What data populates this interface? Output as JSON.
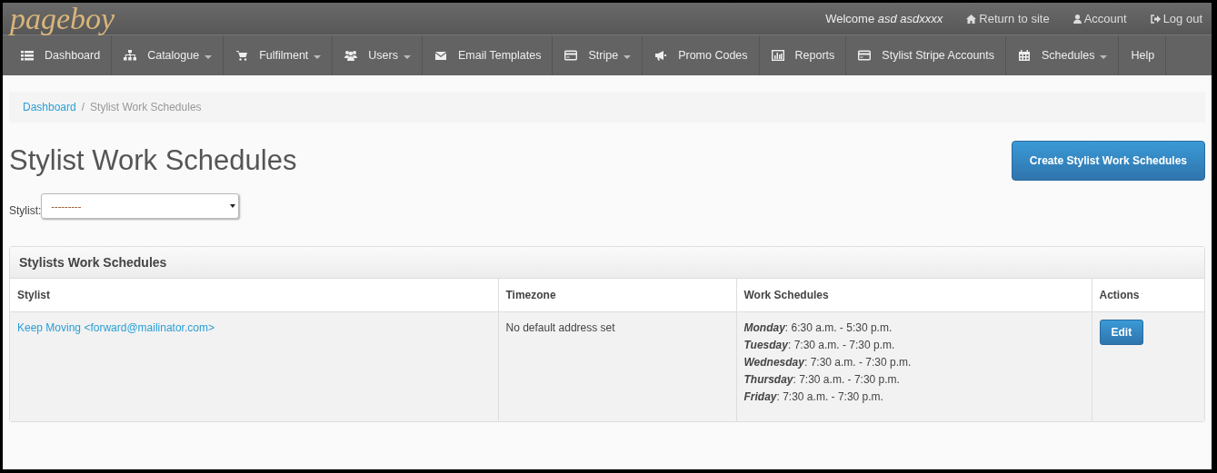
{
  "brand": {
    "logo": "pageboy"
  },
  "topbar": {
    "welcome": "Welcome *asd asdxxxx*",
    "links": [
      "Return to site",
      "Account",
      "Log out"
    ]
  },
  "nav": [
    {
      "label": "Dashboard",
      "dropdown": false
    },
    {
      "label": "Catalogue",
      "dropdown": true
    },
    {
      "label": "Fulfilment",
      "dropdown": true
    },
    {
      "label": "Users",
      "dropdown": true
    },
    {
      "label": "Email Templates",
      "dropdown": false
    },
    {
      "label": "Stripe",
      "dropdown": true
    },
    {
      "label": "Promo Codes",
      "dropdown": false
    },
    {
      "label": "Reports",
      "dropdown": false
    },
    {
      "label": "Stylist Stripe Accounts",
      "dropdown": false
    },
    {
      "label": "Schedules",
      "dropdown": true
    },
    {
      "label": "Help",
      "dropdown": false
    }
  ],
  "breadcrumb_separator": "/",
  "breadcrumb": [
    {
      "label": "Dashboard",
      "selected": false
    },
    {
      "label": "Stylist Work Schedules",
      "selected": true
    }
  ],
  "page_title": "Stylist Work Schedules",
  "create_button": "Create Stylist Work Schedules",
  "filter": {
    "label": "Stylist:",
    "value": "---------"
  },
  "panel": {
    "title": "Stylists Work Schedules",
    "table": {
      "columns": [
        "Stylist",
        "Timezone",
        "Work Schedules",
        "Actions"
      ],
      "rows": [
        {
          "stylist": "Keep Moving <forward@mailinator.com>",
          "timezone": "No default address set",
          "schedules": [
            "*Monday*: 6:30 a.m. - 5:30 p.m.",
            "*Tuesday*: 7:30 a.m. - 7:30 p.m.",
            "*Wednesday*: 7:30 a.m. - 7:30 p.m.",
            "*Thursday*: 7:30 a.m. - 7:30 p.m.",
            "*Friday*: 7:30 a.m. - 7:30 p.m."
          ],
          "action": "Edit"
        }
      ]
    }
  }
}
